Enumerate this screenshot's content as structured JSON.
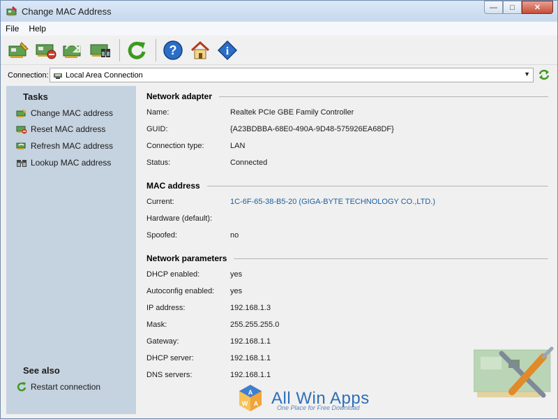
{
  "window": {
    "title": "Change MAC Address"
  },
  "menu": [
    "File",
    "Help"
  ],
  "connection": {
    "label": "Connection:",
    "value": "Local Area Connection"
  },
  "sidebar": {
    "tasks_title": "Tasks",
    "tasks": [
      "Change MAC address",
      "Reset MAC address",
      "Refresh MAC address",
      "Lookup MAC address"
    ],
    "see_also_title": "See also",
    "see_also": [
      "Restart connection"
    ]
  },
  "sections": {
    "adapter": {
      "title": "Network adapter",
      "rows": [
        {
          "label": "Name:",
          "value": "Realtek PCIe GBE Family Controller"
        },
        {
          "label": "GUID:",
          "value": "{A23BDBBA-68E0-490A-9D48-575926EA68DF}"
        },
        {
          "label": "Connection type:",
          "value": "LAN"
        },
        {
          "label": "Status:",
          "value": "Connected"
        }
      ]
    },
    "mac": {
      "title": "MAC address",
      "rows": [
        {
          "label": "Current:",
          "value": "1C-6F-65-38-B5-20 (GIGA-BYTE TECHNOLOGY CO.,LTD.)"
        },
        {
          "label": "Hardware (default):",
          "value": ""
        },
        {
          "label": "Spoofed:",
          "value": "no"
        }
      ]
    },
    "params": {
      "title": "Network parameters",
      "rows": [
        {
          "label": "DHCP enabled:",
          "value": "yes"
        },
        {
          "label": "Autoconfig enabled:",
          "value": "yes"
        },
        {
          "label": "IP address:",
          "value": "192.168.1.3"
        },
        {
          "label": "Mask:",
          "value": "255.255.255.0"
        },
        {
          "label": "Gateway:",
          "value": "192.168.1.1"
        },
        {
          "label": "DHCP server:",
          "value": "192.168.1.1"
        },
        {
          "label": "DNS servers:",
          "value": "192.168.1.1"
        }
      ]
    }
  },
  "watermark": {
    "text": "All Win Apps",
    "sub": "One Place for Free Download"
  },
  "colors": {
    "sidebar": "#c5d2df",
    "link": "#1a5fa0",
    "title_gradient": "#c6d8ee"
  }
}
